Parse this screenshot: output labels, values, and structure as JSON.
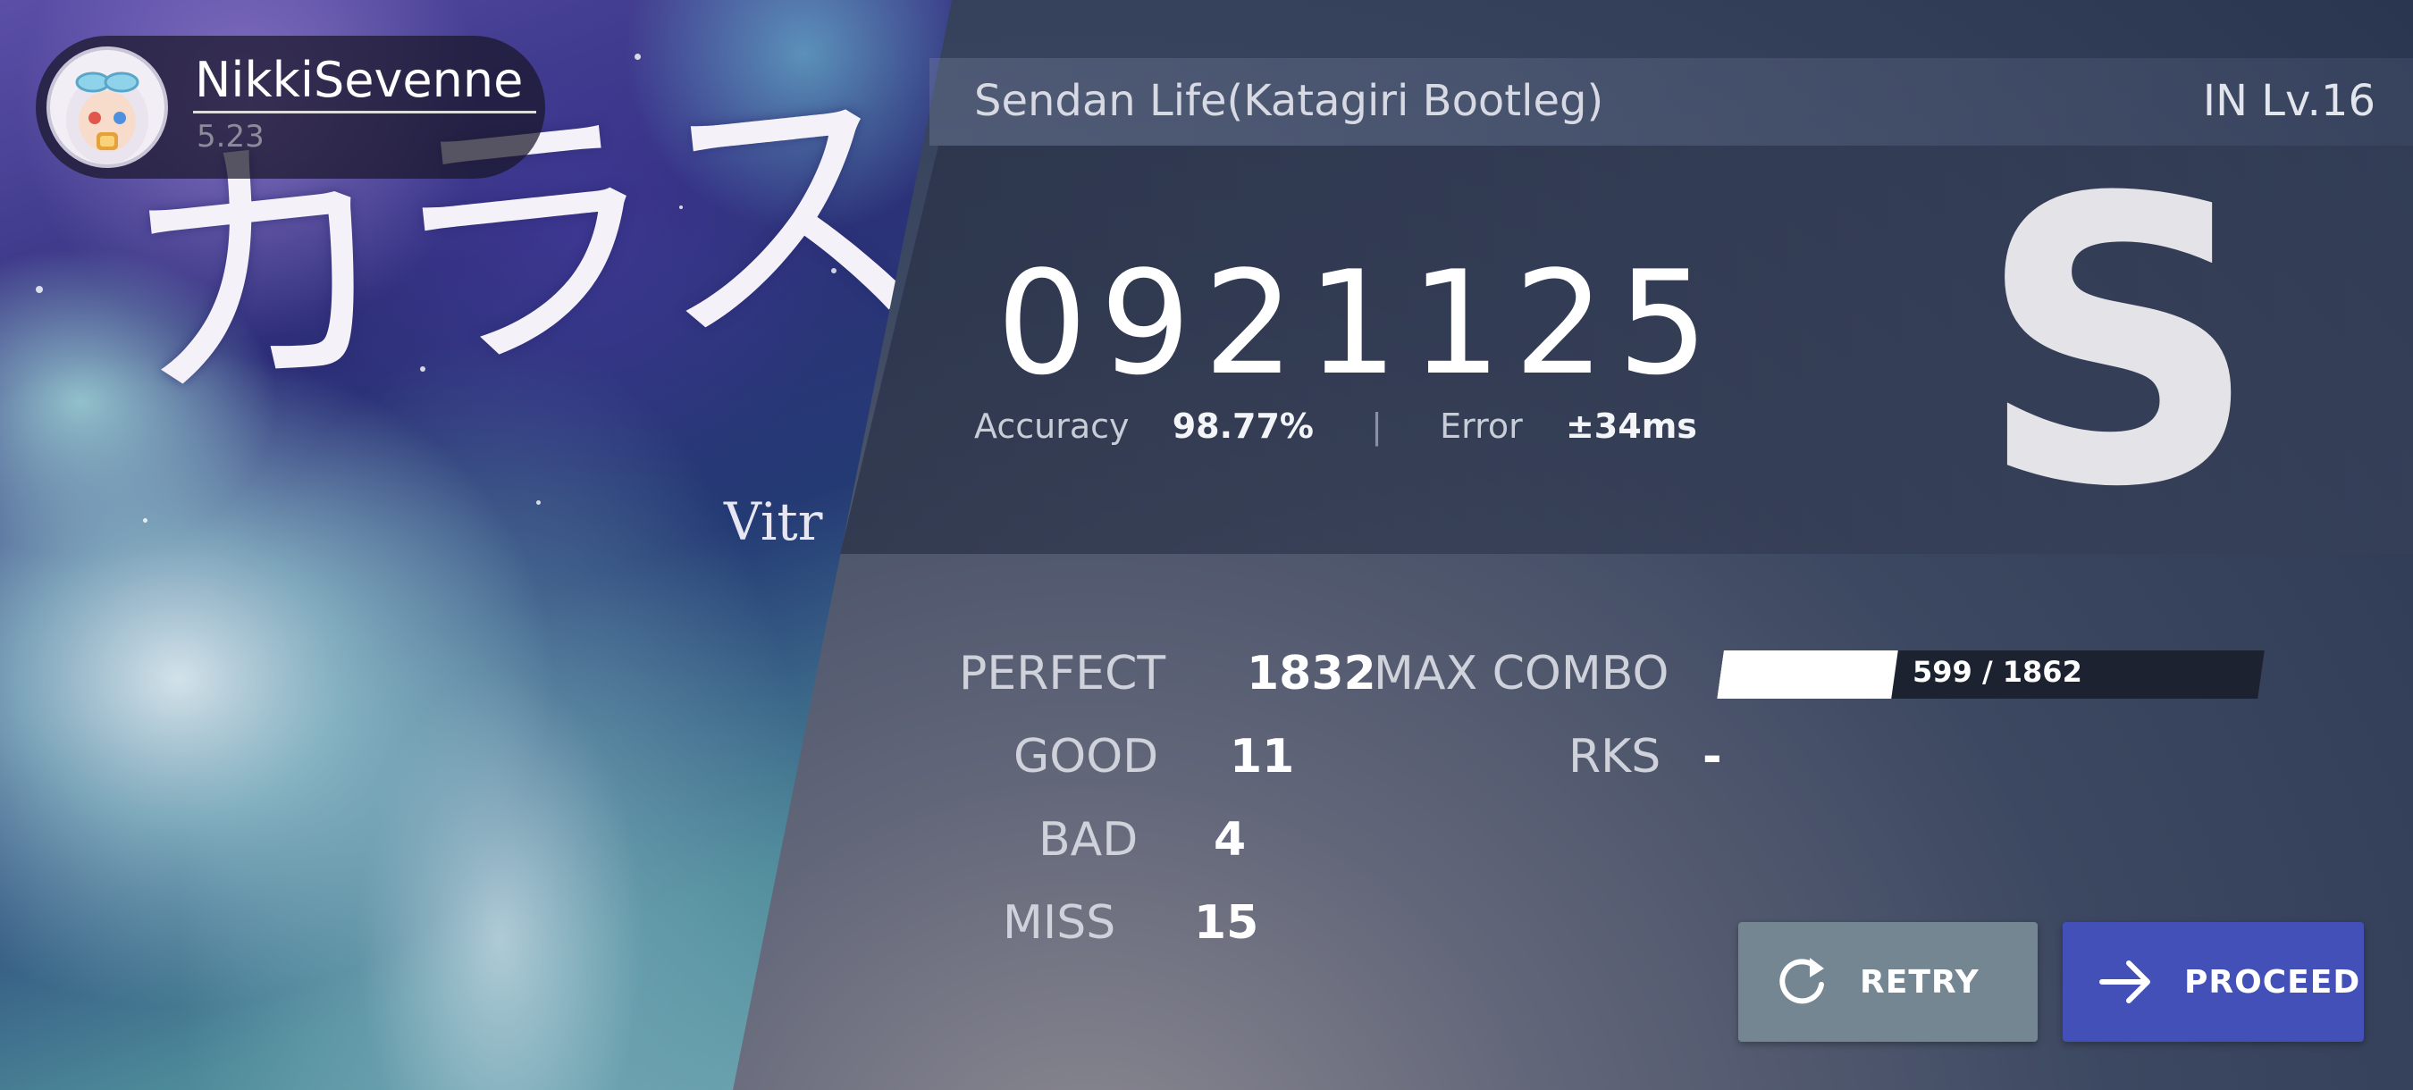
{
  "player": {
    "name": "NikkiSevenne",
    "rks": "5.23",
    "avatar_icon": "avatar-girl-icon"
  },
  "song": {
    "art_title": "カラスの",
    "art_subtitle": "Vitr",
    "title": "Sendan Life(Katagiri Bootleg)",
    "difficulty": "IN Lv.16"
  },
  "result": {
    "score": "0921125",
    "accuracy_label": "Accuracy",
    "accuracy": "98.77%",
    "separator": "|",
    "error_label": "Error",
    "error": "±34ms",
    "grade": "S"
  },
  "judgements": {
    "perfect_label": "PERFECT",
    "perfect": "1832",
    "good_label": "GOOD",
    "good": "11",
    "bad_label": "BAD",
    "bad": "4",
    "miss_label": "MISS",
    "miss": "15",
    "max_combo_label": "MAX COMBO",
    "max_combo": 599,
    "total_notes": 1862,
    "max_combo_text": "599 / 1862",
    "rks_label": "RKS",
    "rks_value": "-"
  },
  "buttons": {
    "retry": "RETRY",
    "proceed": "PROCEED"
  },
  "colors": {
    "retry_bg": "#738692",
    "proceed_bg": "#4250b8"
  }
}
